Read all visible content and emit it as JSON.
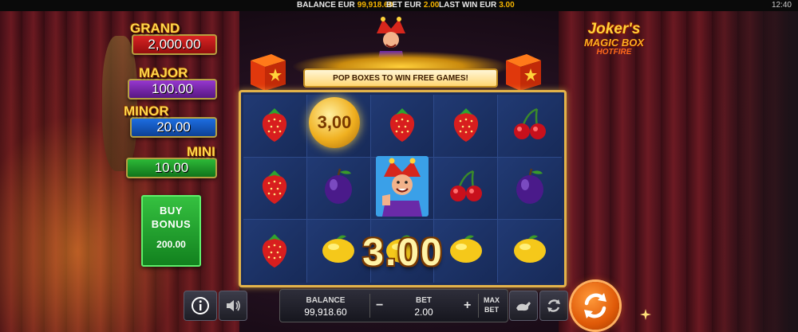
{
  "top_bar": {
    "balance_label": "BALANCE EUR",
    "balance_value": "99,918.60",
    "bet_label": "BET EUR",
    "bet_value": "2.00",
    "last_win_label": "LAST WIN EUR",
    "last_win_value": "3.00",
    "clock": "12:40"
  },
  "jackpots": [
    {
      "label": "GRAND",
      "amount": "2,000.00",
      "color": "#e02626"
    },
    {
      "label": "MAJOR",
      "amount": "100.00",
      "color": "#9c3ad6"
    },
    {
      "label": "MINOR",
      "amount": "20.00",
      "color": "#1e72e8"
    },
    {
      "label": "MINI",
      "amount": "10.00",
      "color": "#2fbf3a"
    }
  ],
  "buy_bonus": {
    "line1": "BUY",
    "line2": "BONUS",
    "price": "200.00"
  },
  "logo": {
    "line1": "Joker's",
    "line2": "MAGIC BOX",
    "line3": "HOTFIRE"
  },
  "banner": "POP BOXES TO WIN FREE GAMES!",
  "reels": [
    [
      "strawberry-icon",
      "coin-icon",
      "strawberry-icon",
      "strawberry-icon",
      "cherry-icon"
    ],
    [
      "strawberry-icon",
      "plum-icon",
      "joker-wild-icon",
      "cherry-icon",
      "plum-icon"
    ],
    [
      "strawberry-icon",
      "lemon-icon",
      "lemon-icon",
      "lemon-icon",
      "lemon-icon"
    ]
  ],
  "coin_value": "3,00",
  "win_amount": "3.00",
  "controls": {
    "balance_label": "BALANCE",
    "balance_value": "99,918.60",
    "bet_label": "BET",
    "bet_value": "2.00",
    "minus": "−",
    "plus": "+",
    "max_bet_line1": "MAX",
    "max_bet_line2": "BET"
  },
  "colors": {
    "accent": "#f5b400",
    "spin": "#e05a08",
    "frame": "#e3b34a"
  }
}
